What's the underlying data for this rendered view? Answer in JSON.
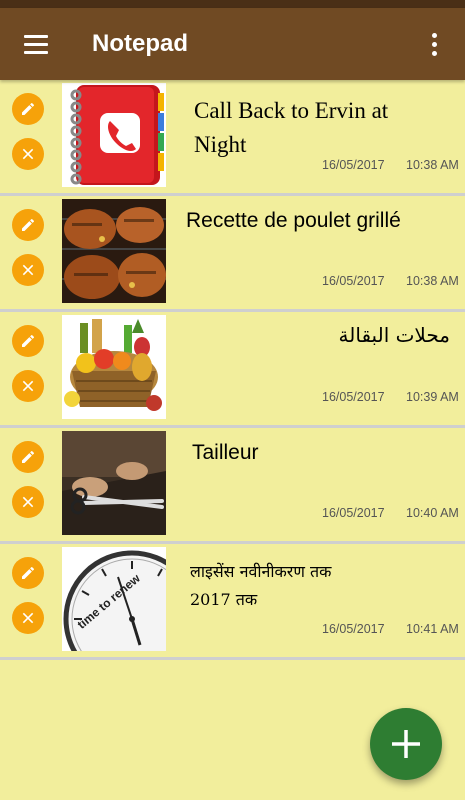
{
  "app": {
    "title": "Notepad",
    "menu_icon": "hamburger-menu-icon",
    "overflow_icon": "more-vert-icon",
    "colors": {
      "statusbar": "#4a2f16",
      "appbar": "#704a23",
      "background": "#f2ee9c",
      "action_button": "#f6a20a",
      "fab": "#2e7d32"
    }
  },
  "notes": [
    {
      "title_line1": "Call Back to Ervin at",
      "title_line2": "Night",
      "date": "16/05/2017",
      "time": "10:38 AM",
      "thumbnail": "phone-contact-book-icon"
    },
    {
      "title_line1": "Recette de poulet grillé",
      "title_line2": "",
      "date": "16/05/2017",
      "time": "10:38 AM",
      "thumbnail": "grilled-chicken-photo"
    },
    {
      "title_line1": "محلات البقالة",
      "title_line2": "",
      "date": "16/05/2017",
      "time": "10:39 AM",
      "thumbnail": "grocery-basket-photo"
    },
    {
      "title_line1": "Tailleur",
      "title_line2": "",
      "date": "16/05/2017",
      "time": "10:40 AM",
      "thumbnail": "tailor-scissors-photo"
    },
    {
      "title_line1": "लाइसेंस नवीनीकरण तक",
      "title_line2": "2017 तक",
      "date": "16/05/2017",
      "time": "10:41 AM",
      "thumbnail": "time-to-renew-clock-image"
    }
  ],
  "clock_text": "time to renew",
  "fab": {
    "icon": "plus-icon"
  }
}
